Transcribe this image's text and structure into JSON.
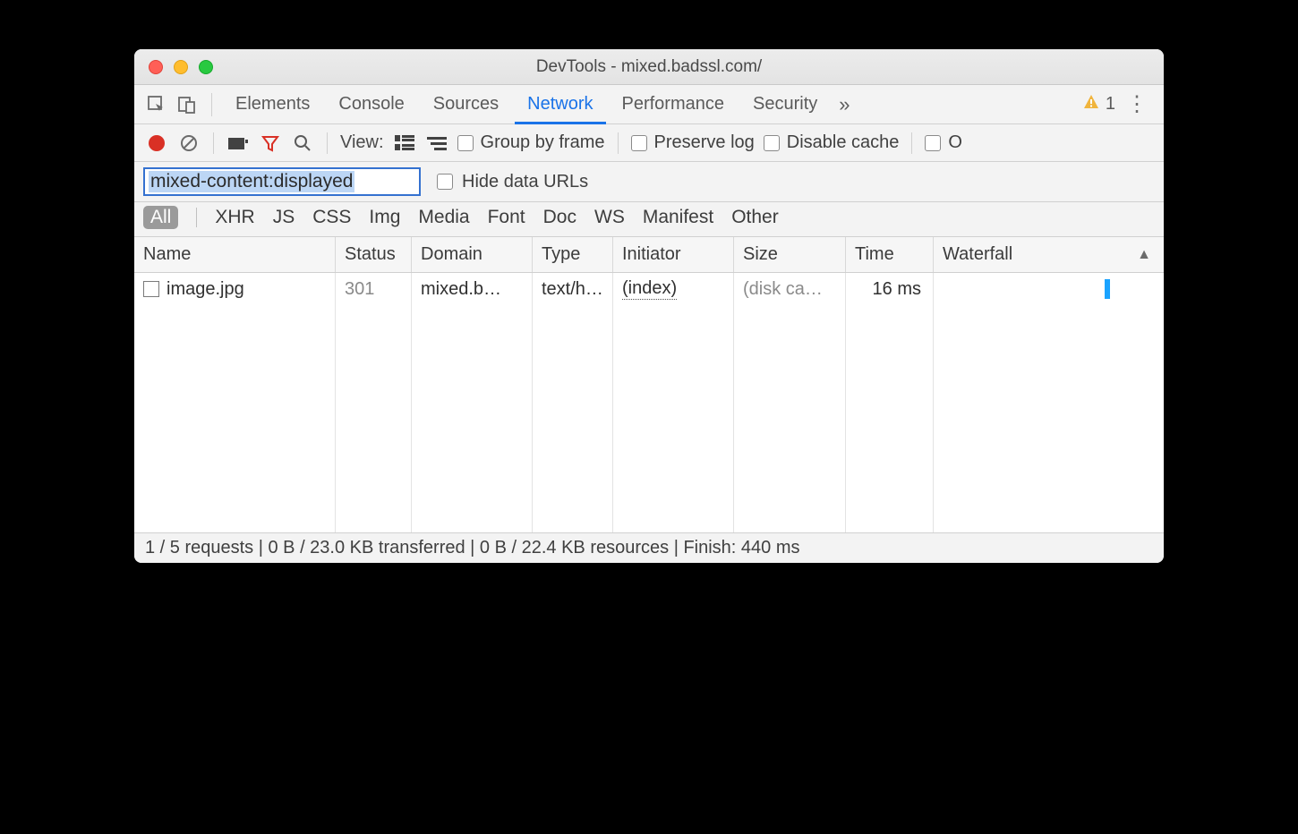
{
  "window": {
    "title": "DevTools - mixed.badssl.com/"
  },
  "tabs": {
    "items": [
      "Elements",
      "Console",
      "Sources",
      "Network",
      "Performance",
      "Security"
    ],
    "active": "Network",
    "warning_count": "1"
  },
  "toolbar": {
    "view_label": "View:",
    "group_by_frame": "Group by frame",
    "preserve_log": "Preserve log",
    "disable_cache": "Disable cache"
  },
  "filter": {
    "value": "mixed-content:displayed",
    "hide_data_urls": "Hide data URLs"
  },
  "type_filters": [
    "All",
    "XHR",
    "JS",
    "CSS",
    "Img",
    "Media",
    "Font",
    "Doc",
    "WS",
    "Manifest",
    "Other"
  ],
  "columns": [
    "Name",
    "Status",
    "Domain",
    "Type",
    "Initiator",
    "Size",
    "Time",
    "Waterfall"
  ],
  "rows": [
    {
      "name": "image.jpg",
      "status": "301",
      "domain": "mixed.b…",
      "type": "text/h…",
      "initiator": "(index)",
      "size": "(disk ca…",
      "time": "16 ms"
    }
  ],
  "status": "1 / 5 requests | 0 B / 23.0 KB transferred | 0 B / 22.4 KB resources | Finish: 440 ms"
}
